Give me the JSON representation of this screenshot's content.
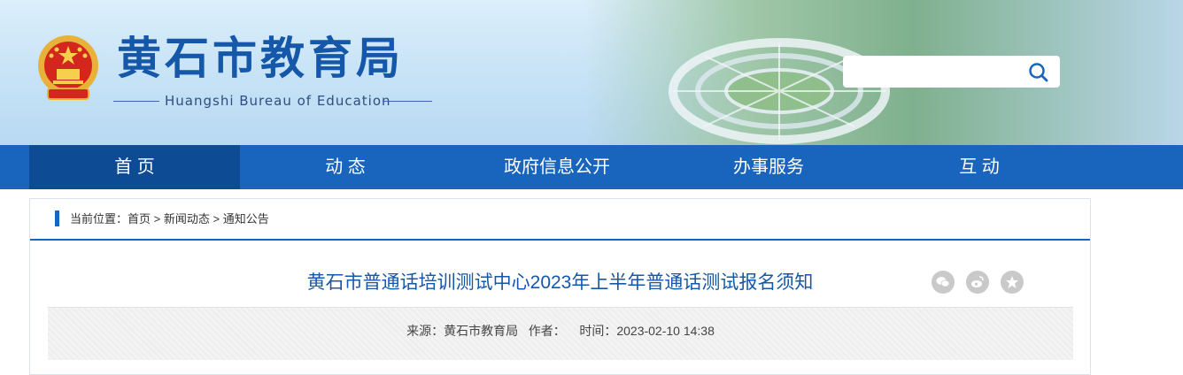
{
  "header": {
    "title": "黄石市教育局",
    "subtitle": "Huangshi Bureau of Education",
    "search": {
      "placeholder": "",
      "value": ""
    }
  },
  "nav": {
    "items": [
      {
        "label": "首 页"
      },
      {
        "label": "动 态"
      },
      {
        "label": "政府信息公开"
      },
      {
        "label": "办事服务"
      },
      {
        "label": "互 动"
      }
    ]
  },
  "breadcrumb": {
    "prefix": "当前位置：",
    "items": [
      "首页",
      "新闻动态",
      "通知公告"
    ],
    "separator": " > "
  },
  "article": {
    "title": "黄石市普通话培训测试中心2023年上半年普通话测试报名须知",
    "source_label": "来源：",
    "source": "黄石市教育局",
    "author_label": "作者：",
    "author": "",
    "time_label": "时间：",
    "time": "2023-02-10 14:38"
  },
  "share_icons": [
    "wechat-icon",
    "weibo-icon",
    "favorite-star-icon"
  ],
  "colors": {
    "primary": "#1964bd",
    "active_nav": "#0e4b95",
    "title_blue": "#1557a8"
  }
}
